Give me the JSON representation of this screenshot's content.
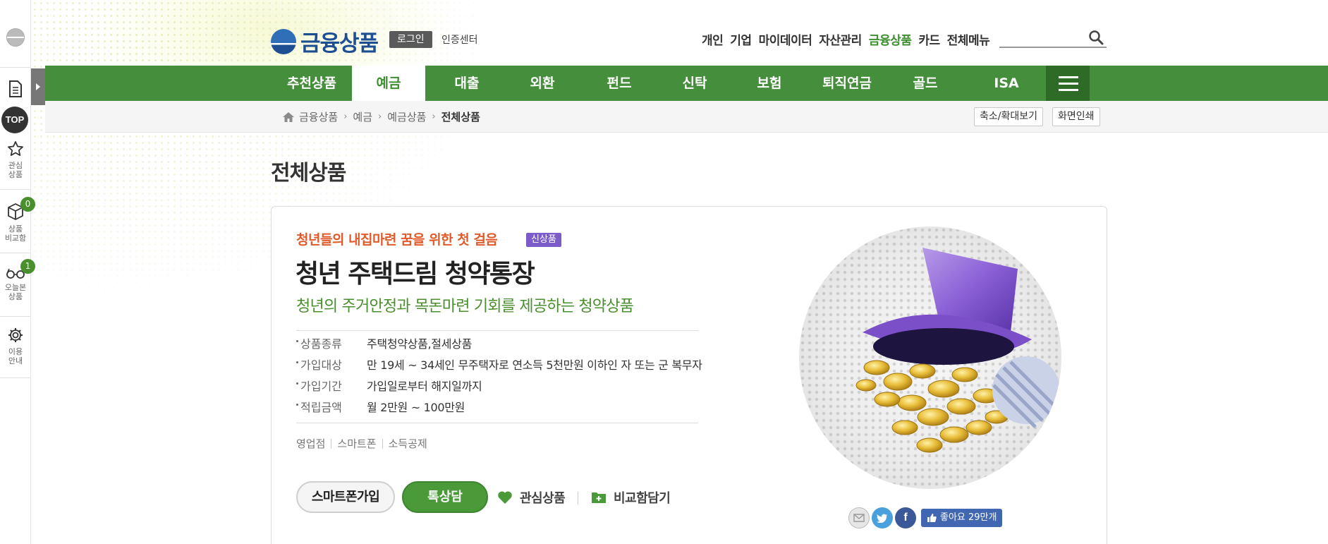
{
  "header": {
    "logo_text": "금융상품",
    "login_label": "로그인",
    "cert_label": "인증센터",
    "top_nav": [
      "개인",
      "기업",
      "마이데이터",
      "자산관리",
      "금융상품",
      "카드",
      "전체메뉴"
    ],
    "top_nav_active": "금융상품",
    "search_placeholder": "",
    "search_icon": "search-icon"
  },
  "gnb": {
    "items": [
      "추천상품",
      "예금",
      "대출",
      "외환",
      "펀드",
      "신탁",
      "보험",
      "퇴직연금",
      "골드",
      "ISA"
    ],
    "active": "예금",
    "menu_icon": "hamburger-icon"
  },
  "breadcrumb": {
    "items": [
      "금융상품",
      "예금",
      "예금상품",
      "전체상품"
    ],
    "home_icon": "home-icon",
    "zoom_label": "축소/확대보기",
    "print_label": "화면인쇄"
  },
  "quickbar": {
    "top_label": "TOP",
    "items": [
      {
        "label": "관심\n상품",
        "icon": "star-icon"
      },
      {
        "label": "상품\n비교함",
        "icon": "cube-icon",
        "badge": "0"
      },
      {
        "label": "오늘본\n상품",
        "icon": "glasses-icon",
        "badge": "1"
      },
      {
        "label": "이용\n안내",
        "icon": "gear-icon"
      }
    ]
  },
  "page": {
    "title": "전체상품"
  },
  "product": {
    "eyebrow": "청년들의 내집마련 꿈을 위한 첫 걸음",
    "badge": "신상품",
    "name": "청년 주택드림 청약통장",
    "description": "청년의 주거안정과 목돈마련 기회를 제공하는 청약상품",
    "specs": [
      {
        "key": "상품종류",
        "value": "주택청약상품,절세상품"
      },
      {
        "key": "가입대상",
        "value": "만 19세 ~ 34세인 무주택자로 연소득 5천만원 이하인 자 또는 군 복무자"
      },
      {
        "key": "가입기간",
        "value": "가입일로부터 해지일까지"
      },
      {
        "key": "적립금액",
        "value": "월 2만원 ~ 100만원"
      }
    ],
    "channels": [
      "영업점",
      "스마트폰",
      "소득공제"
    ],
    "btn_smart": "스마트폰가입",
    "btn_consult": "톡상담",
    "favorite_label": "관심상품",
    "compare_label": "비교함담기",
    "like_label": "좋아요 29만개",
    "colors": {
      "accent_green": "#458e3c",
      "eyebrow_orange": "#e05a2b",
      "badge_purple": "#7b5cc9"
    }
  }
}
